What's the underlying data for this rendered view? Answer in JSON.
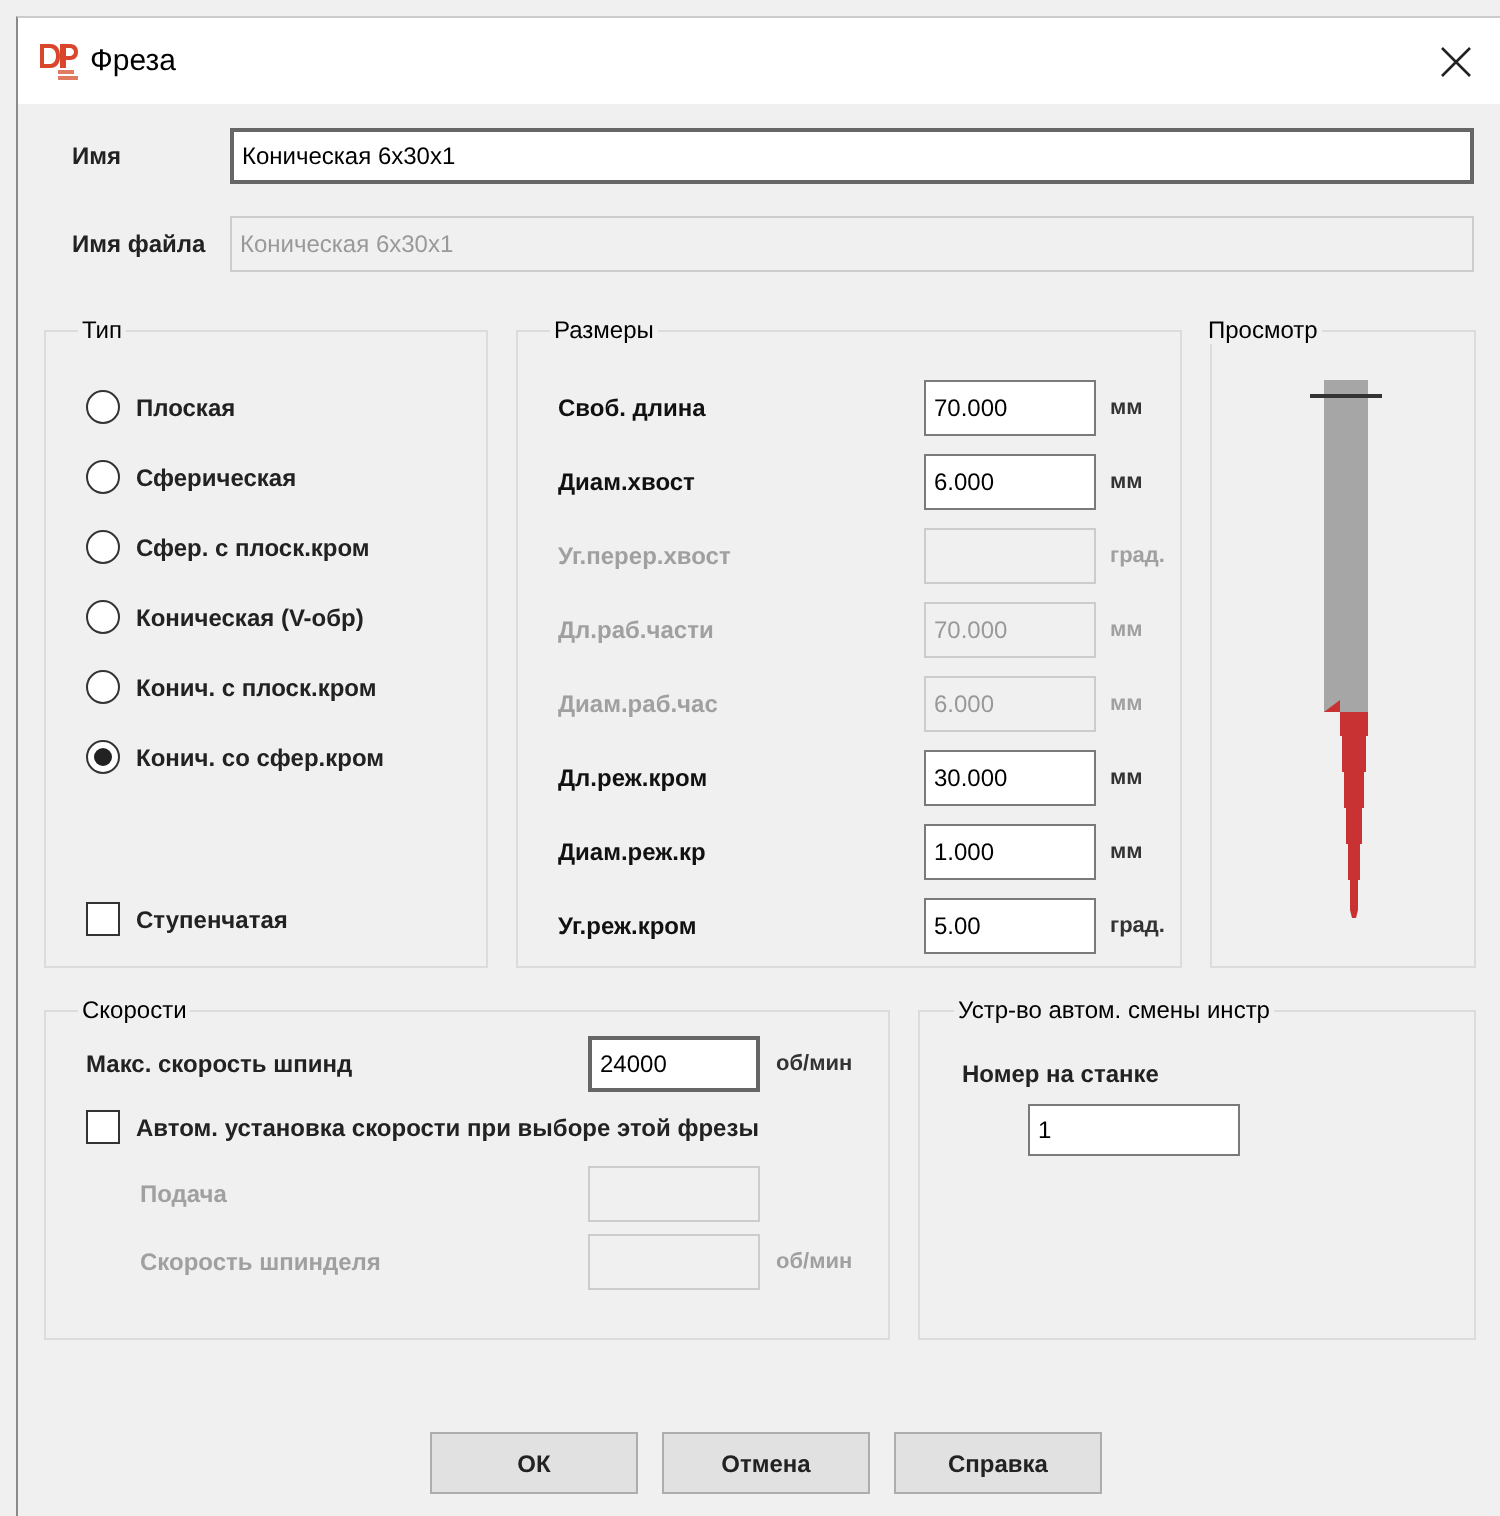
{
  "window": {
    "title": "Фреза"
  },
  "name": {
    "label": "Имя",
    "value": "Коническая 6x30x1",
    "disabled": false
  },
  "filename": {
    "label": "Имя файла",
    "value": "Коническая 6x30x1",
    "disabled": true
  },
  "type_group": {
    "title": "Тип",
    "options": [
      {
        "label": "Плоская",
        "selected": false
      },
      {
        "label": "Сферическая",
        "selected": false
      },
      {
        "label": "Сфер. с плоск.кром",
        "selected": false
      },
      {
        "label": "Коническая (V-обр)",
        "selected": false
      },
      {
        "label": "Конич. с плоск.кром",
        "selected": false
      },
      {
        "label": "Конич. со сфер.кром",
        "selected": true
      }
    ],
    "stepped": {
      "label": "Ступенчатая",
      "checked": false
    }
  },
  "dimensions": {
    "title": "Размеры",
    "rows": [
      {
        "label": "Своб. длина",
        "value": "70.000",
        "unit": "мм",
        "disabled": false
      },
      {
        "label": "Диам.хвост",
        "value": "6.000",
        "unit": "мм",
        "disabled": false
      },
      {
        "label": "Уг.перер.хвост",
        "unit": "град.",
        "disabled": true
      },
      {
        "label": "Дл.раб.части",
        "value": "70.000",
        "unit": "мм",
        "disabled": true
      },
      {
        "label": "Диам.раб.час",
        "value": "6.000",
        "unit": "мм",
        "disabled": true
      },
      {
        "label": "Дл.реж.кром",
        "value": "30.000",
        "unit": "мм",
        "disabled": false
      },
      {
        "label": "Диам.реж.кр",
        "value": "1.000",
        "unit": "мм",
        "disabled": false
      },
      {
        "label": "Уг.реж.кром",
        "value": "5.00",
        "unit": "град.",
        "disabled": false
      }
    ]
  },
  "preview": {
    "title": "Просмотр"
  },
  "speeds": {
    "title": "Скорости",
    "max_speed": {
      "label": "Макс. скорость шпинд",
      "value": "24000",
      "unit": "об/мин",
      "disabled": false
    },
    "auto": {
      "label": "Автом. установка скорости при выборе этой фрезы",
      "checked": false
    },
    "rows": [
      {
        "label": "Подача",
        "disabled": true
      },
      {
        "label": "Скорость шпинделя",
        "unit": "об/мин",
        "disabled": true
      }
    ]
  },
  "tool_changer": {
    "title": "Устр-во автом. смены инстр",
    "label": "Номер на станке",
    "value": "1"
  },
  "buttons": [
    "ОК",
    "Отмена",
    "Справка"
  ]
}
